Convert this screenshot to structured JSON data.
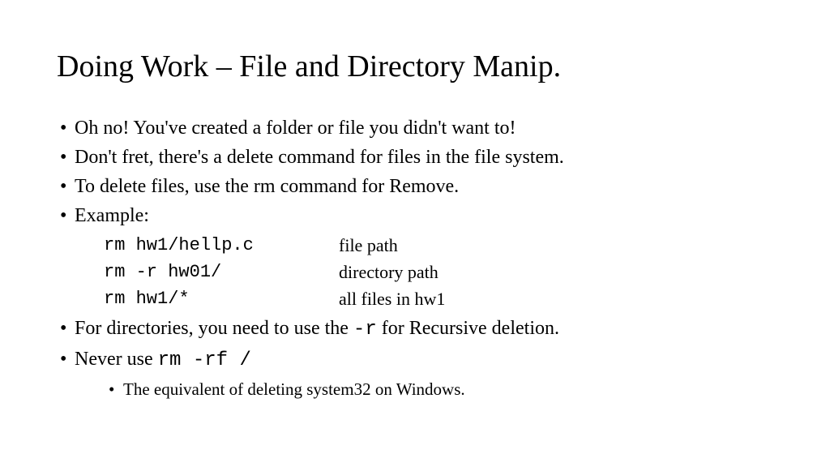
{
  "title": "Doing Work – File and Directory Manip.",
  "bullets": {
    "b1": "Oh no! You've created a folder or file you didn't want to!",
    "b2": "Don't fret, there's a delete command for files in the file system.",
    "b3": "To delete files, use the rm command for Remove.",
    "b4": "Example:",
    "b5_prefix": "For directories, you need to use the ",
    "b5_code": "-r",
    "b5_suffix": " for Recursive deletion.",
    "b6_prefix": "Never use ",
    "b6_code": "rm -rf /",
    "sub1": "The equivalent of deleting system32 on Windows."
  },
  "examples": [
    {
      "cmd": "rm hw1/hellp.c",
      "desc": "file path"
    },
    {
      "cmd": "rm -r hw01/",
      "desc": "directory path"
    },
    {
      "cmd": "rm hw1/*",
      "desc": "all files in hw1"
    }
  ]
}
